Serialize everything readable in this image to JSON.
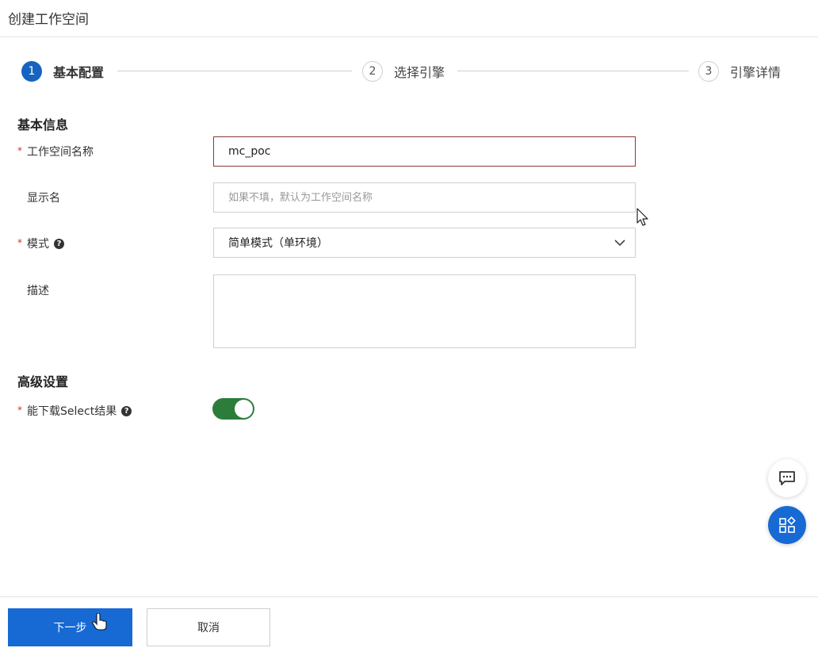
{
  "header": {
    "title": "创建工作空间"
  },
  "steps": [
    {
      "num": "1",
      "label": "基本配置"
    },
    {
      "num": "2",
      "label": "选择引擎"
    },
    {
      "num": "3",
      "label": "引擎详情"
    }
  ],
  "basic_info": {
    "section_title": "基本信息",
    "required_mark": "*",
    "workspace_name": {
      "label": "工作空间名称",
      "value": "mc_poc"
    },
    "display_name": {
      "label": "显示名",
      "placeholder": "如果不填，默认为工作空间名称"
    },
    "mode": {
      "label": "模式",
      "selected": "简单模式（单环境）"
    },
    "description": {
      "label": "描述",
      "value": ""
    }
  },
  "advanced": {
    "section_title": "高级设置",
    "download_select": {
      "label": "能下载Select结果",
      "enabled": true
    }
  },
  "footer": {
    "next_label": "下一步",
    "cancel_label": "取消"
  },
  "colors": {
    "primary": "#1769d4",
    "toggle_on": "#2c7d3a",
    "required": "#d93026"
  },
  "icons": {
    "help": "help-circle-icon",
    "dropdown": "chevron-down-icon",
    "feedback": "chat-bubble-icon",
    "apps": "apps-grid-icon"
  }
}
